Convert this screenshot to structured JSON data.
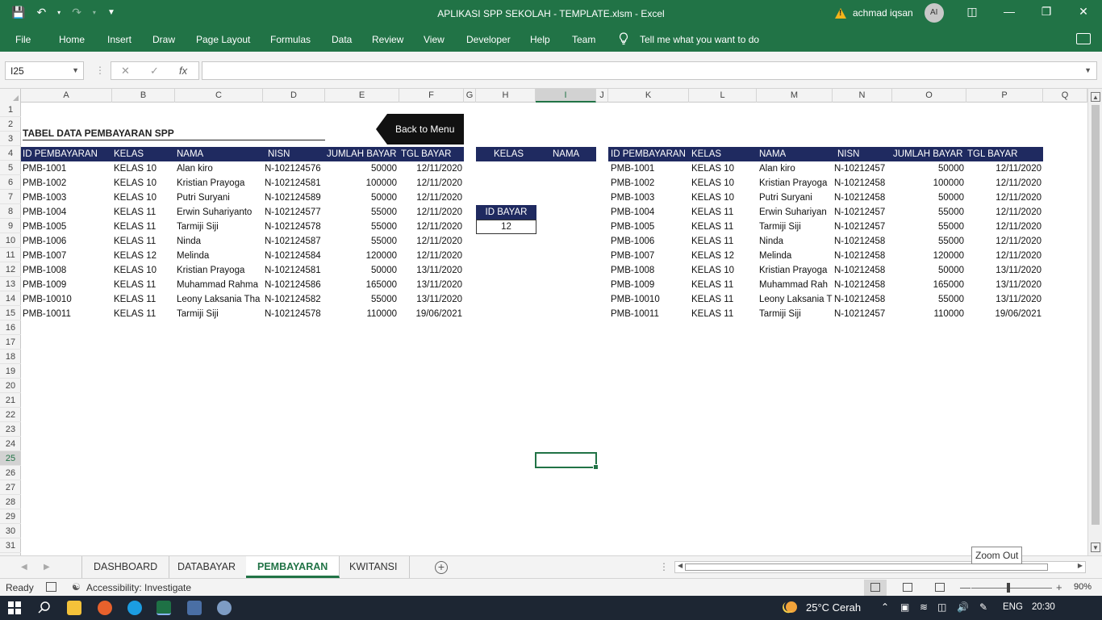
{
  "window": {
    "title": "APLIKASI SPP SEKOLAH - TEMPLATE.xlsm  -  Excel",
    "user_name": "achmad iqsan",
    "user_initials": "AI"
  },
  "ribbon": {
    "tabs": [
      "File",
      "Home",
      "Insert",
      "Draw",
      "Page Layout",
      "Formulas",
      "Data",
      "Review",
      "View",
      "Developer",
      "Help",
      "Team"
    ],
    "tell_me": "Tell me what you want to do"
  },
  "formula_bar": {
    "name_box": "I25",
    "formula": "",
    "fx_label": "fx"
  },
  "columns": [
    "A",
    "B",
    "C",
    "D",
    "E",
    "F",
    "G",
    "H",
    "I",
    "J",
    "K",
    "L",
    "M",
    "N",
    "O",
    "P",
    "Q"
  ],
  "rows": [
    "1",
    "2",
    "3",
    "4",
    "5",
    "6",
    "7",
    "8",
    "9",
    "10",
    "11",
    "12",
    "13",
    "14",
    "15",
    "16",
    "17",
    "18",
    "19",
    "20",
    "21",
    "22",
    "23",
    "24",
    "25",
    "26",
    "27",
    "28",
    "29",
    "30",
    "31"
  ],
  "sheet": {
    "title": "TABEL DATA PEMBAYARAN SPP",
    "back_button": "Back to Menu",
    "headers": [
      "ID PEMBAYARAN",
      "KELAS",
      "NAMA",
      "NISN",
      "JUMLAH BAYAR",
      "TGL BAYAR"
    ],
    "records": [
      {
        "id": "PMB-1001",
        "kelas": "KELAS 10",
        "nama": "Alan kiro",
        "nisn": "N-102124576",
        "jumlah": "50000",
        "tgl": "12/11/2020"
      },
      {
        "id": "PMB-1002",
        "kelas": "KELAS 10",
        "nama": "Kristian Prayoga",
        "nisn": "N-102124581",
        "jumlah": "100000",
        "tgl": "12/11/2020"
      },
      {
        "id": "PMB-1003",
        "kelas": "KELAS 10",
        "nama": "Putri Suryani",
        "nisn": "N-102124589",
        "jumlah": "50000",
        "tgl": "12/11/2020"
      },
      {
        "id": "PMB-1004",
        "kelas": "KELAS 11",
        "nama": "Erwin Suhariyanto",
        "nisn": "N-102124577",
        "jumlah": "55000",
        "tgl": "12/11/2020"
      },
      {
        "id": "PMB-1005",
        "kelas": "KELAS 11",
        "nama": "Tarmiji Siji",
        "nisn": "N-102124578",
        "jumlah": "55000",
        "tgl": "12/11/2020"
      },
      {
        "id": "PMB-1006",
        "kelas": "KELAS 11",
        "nama": "Ninda",
        "nisn": "N-102124587",
        "jumlah": "55000",
        "tgl": "12/11/2020"
      },
      {
        "id": "PMB-1007",
        "kelas": "KELAS 12",
        "nama": "Melinda",
        "nisn": "N-102124584",
        "jumlah": "120000",
        "tgl": "12/11/2020"
      },
      {
        "id": "PMB-1008",
        "kelas": "KELAS 10",
        "nama": "Kristian Prayoga",
        "nisn": "N-102124581",
        "jumlah": "50000",
        "tgl": "13/11/2020"
      },
      {
        "id": "PMB-1009",
        "kelas": "KELAS 11",
        "nama": "Muhammad Rahma",
        "nisn": "N-102124586",
        "jumlah": "165000",
        "tgl": "13/11/2020"
      },
      {
        "id": "PMB-10010",
        "kelas": "KELAS 11",
        "nama": "Leony Laksania Tha",
        "nisn": "N-102124582",
        "jumlah": "55000",
        "tgl": "13/11/2020"
      },
      {
        "id": "PMB-10011",
        "kelas": "KELAS 11",
        "nama": "Tarmiji Siji",
        "nisn": "N-102124578",
        "jumlah": "110000",
        "tgl": "19/06/2021"
      }
    ],
    "filter_headers": [
      "KELAS",
      "NAMA"
    ],
    "id_bayar_label": "ID BAYAR",
    "id_bayar_value": "12",
    "right_headers": [
      "ID PEMBAYARAN",
      "KELAS",
      "NAMA",
      "NISN",
      "JUMLAH BAYAR",
      "TGL BAYAR"
    ],
    "right_records": [
      {
        "id": "PMB-1001",
        "kelas": "KELAS 10",
        "nama": "Alan kiro",
        "nisn": "N-10212457",
        "jumlah": "50000",
        "tgl": "12/11/2020"
      },
      {
        "id": "PMB-1002",
        "kelas": "KELAS 10",
        "nama": "Kristian Prayoga",
        "nisn": "N-10212458",
        "jumlah": "100000",
        "tgl": "12/11/2020"
      },
      {
        "id": "PMB-1003",
        "kelas": "KELAS 10",
        "nama": "Putri Suryani",
        "nisn": "N-10212458",
        "jumlah": "50000",
        "tgl": "12/11/2020"
      },
      {
        "id": "PMB-1004",
        "kelas": "KELAS 11",
        "nama": "Erwin Suhariyan",
        "nisn": "N-10212457",
        "jumlah": "55000",
        "tgl": "12/11/2020"
      },
      {
        "id": "PMB-1005",
        "kelas": "KELAS 11",
        "nama": "Tarmiji Siji",
        "nisn": "N-10212457",
        "jumlah": "55000",
        "tgl": "12/11/2020"
      },
      {
        "id": "PMB-1006",
        "kelas": "KELAS 11",
        "nama": "Ninda",
        "nisn": "N-10212458",
        "jumlah": "55000",
        "tgl": "12/11/2020"
      },
      {
        "id": "PMB-1007",
        "kelas": "KELAS 12",
        "nama": "Melinda",
        "nisn": "N-10212458",
        "jumlah": "120000",
        "tgl": "12/11/2020"
      },
      {
        "id": "PMB-1008",
        "kelas": "KELAS 10",
        "nama": "Kristian Prayoga",
        "nisn": "N-10212458",
        "jumlah": "50000",
        "tgl": "13/11/2020"
      },
      {
        "id": "PMB-1009",
        "kelas": "KELAS 11",
        "nama": "Muhammad Rah",
        "nisn": "N-10212458",
        "jumlah": "165000",
        "tgl": "13/11/2020"
      },
      {
        "id": "PMB-10010",
        "kelas": "KELAS 11",
        "nama": "Leony Laksania T",
        "nisn": "N-10212458",
        "jumlah": "55000",
        "tgl": "13/11/2020"
      },
      {
        "id": "PMB-10011",
        "kelas": "KELAS 11",
        "nama": "Tarmiji Siji",
        "nisn": "N-10212457",
        "jumlah": "110000",
        "tgl": "19/06/2021"
      }
    ]
  },
  "sheet_tabs": [
    "DASHBOARD",
    "DATABAYAR",
    "PEMBAYARAN",
    "KWITANSI"
  ],
  "active_sheet": "PEMBAYARAN",
  "tooltip": "Zoom Out",
  "status_bar": {
    "ready": "Ready",
    "accessibility": "Accessibility: Investigate",
    "zoom": "90%"
  },
  "taskbar": {
    "weather": "25°C  Cerah",
    "language": "ENG",
    "time": "20:30"
  },
  "colors": {
    "excel_green": "#217346",
    "table_header": "#1f2a60",
    "taskbar": "#1d2633"
  }
}
